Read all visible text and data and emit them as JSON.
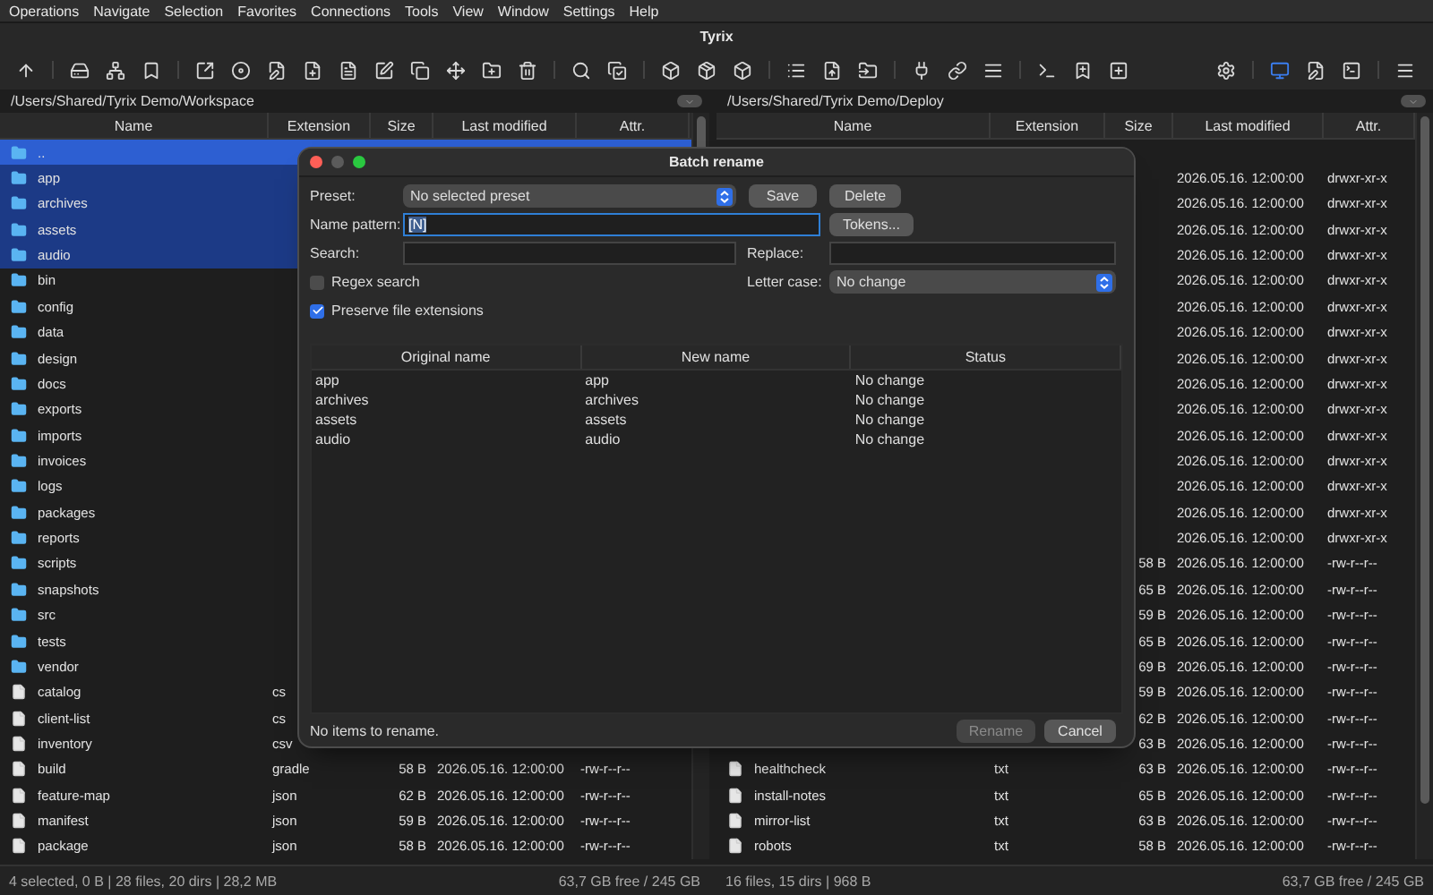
{
  "menu": [
    "Operations",
    "Navigate",
    "Selection",
    "Favorites",
    "Connections",
    "Tools",
    "View",
    "Window",
    "Settings",
    "Help"
  ],
  "window": {
    "title": "Tyrix"
  },
  "toolbar": {
    "groups": [
      {
        "buttons": [
          {
            "selected": false
          }
        ]
      },
      {
        "buttons": [
          {
            "selected": false
          },
          {
            "selected": false
          },
          {
            "selected": false
          }
        ]
      },
      {
        "buttons": [
          {
            "selected": false
          },
          {
            "selected": false
          },
          {
            "selected": false
          },
          {
            "selected": false
          },
          {
            "selected": false
          },
          {
            "selected": false
          },
          {
            "selected": false
          },
          {
            "selected": false
          },
          {
            "selected": false
          },
          {
            "selected": false
          }
        ]
      },
      {
        "buttons": [
          {
            "selected": false
          },
          {
            "selected": false
          }
        ]
      },
      {
        "buttons": [
          {
            "selected": false
          },
          {
            "selected": false
          },
          {
            "selected": false
          }
        ]
      },
      {
        "buttons": [
          {
            "selected": false
          },
          {
            "selected": false
          },
          {
            "selected": false
          }
        ]
      },
      {
        "buttons": [
          {
            "selected": false
          },
          {
            "selected": false
          },
          {
            "selected": false
          }
        ]
      },
      {
        "buttons": [
          {
            "selected": false
          },
          {
            "selected": false
          },
          {
            "selected": false
          }
        ]
      },
      {
        "buttons": [
          {
            "selected": false
          }
        ]
      },
      {
        "buttons": [
          {
            "selected": true
          },
          {
            "selected": false
          },
          {
            "selected": false
          }
        ]
      },
      {
        "buttons": [
          {
            "selected": false
          }
        ]
      }
    ]
  },
  "panels": [
    {
      "path": "/Users/Shared/Tyrix Demo/Workspace",
      "columns": [
        "Name",
        "Extension",
        "Size",
        "Last modified",
        "Attr."
      ],
      "rows": [
        {
          "kind": "folder",
          "name": "..",
          "selected": true,
          "focused": true
        },
        {
          "kind": "folder",
          "name": "app",
          "selected": true,
          "focused": false
        },
        {
          "kind": "folder",
          "name": "archives",
          "selected": true,
          "focused": false
        },
        {
          "kind": "folder",
          "name": "assets",
          "selected": true,
          "focused": false
        },
        {
          "kind": "folder",
          "name": "audio",
          "selected": true,
          "focused": false
        },
        {
          "kind": "folder",
          "name": "bin",
          "selected": false,
          "focused": false
        },
        {
          "kind": "folder",
          "name": "config",
          "selected": false,
          "focused": false
        },
        {
          "kind": "folder",
          "name": "data",
          "selected": false,
          "focused": false
        },
        {
          "kind": "folder",
          "name": "design",
          "selected": false,
          "focused": false
        },
        {
          "kind": "folder",
          "name": "docs",
          "selected": false,
          "focused": false
        },
        {
          "kind": "folder",
          "name": "exports",
          "selected": false,
          "focused": false
        },
        {
          "kind": "folder",
          "name": "imports",
          "selected": false,
          "focused": false
        },
        {
          "kind": "folder",
          "name": "invoices",
          "selected": false,
          "focused": false
        },
        {
          "kind": "folder",
          "name": "logs",
          "selected": false,
          "focused": false
        },
        {
          "kind": "folder",
          "name": "packages",
          "selected": false,
          "focused": false
        },
        {
          "kind": "folder",
          "name": "reports",
          "selected": false,
          "focused": false
        },
        {
          "kind": "folder",
          "name": "scripts",
          "selected": false,
          "focused": false
        },
        {
          "kind": "folder",
          "name": "snapshots",
          "selected": false,
          "focused": false
        },
        {
          "kind": "folder",
          "name": "src",
          "selected": false,
          "focused": false
        },
        {
          "kind": "folder",
          "name": "tests",
          "selected": false,
          "focused": false
        },
        {
          "kind": "folder",
          "name": "vendor",
          "selected": false,
          "focused": false
        },
        {
          "kind": "file",
          "name": "catalog",
          "ext": "cs",
          "selected": false,
          "focused": false
        },
        {
          "kind": "file",
          "name": "client-list",
          "ext": "cs",
          "selected": false,
          "focused": false
        },
        {
          "kind": "file",
          "name": "inventory",
          "ext": "csv",
          "selected": false,
          "focused": false
        },
        {
          "kind": "file",
          "name": "build",
          "ext": "gradle",
          "size": "58 B",
          "modified": "2026.05.16. 12:00:00",
          "attr": "-rw-r--r--",
          "selected": false,
          "focused": false
        },
        {
          "kind": "file",
          "name": "feature-map",
          "ext": "json",
          "size": "62 B",
          "modified": "2026.05.16. 12:00:00",
          "attr": "-rw-r--r--",
          "selected": false,
          "focused": false
        },
        {
          "kind": "file",
          "name": "manifest",
          "ext": "json",
          "size": "59 B",
          "modified": "2026.05.16. 12:00:00",
          "attr": "-rw-r--r--",
          "selected": false,
          "focused": false
        },
        {
          "kind": "file",
          "name": "package",
          "ext": "json",
          "size": "58 B",
          "modified": "2026.05.16. 12:00:00",
          "attr": "-rw-r--r--",
          "selected": false,
          "focused": false
        }
      ],
      "status": {
        "summary": "4 selected, 0 B | 28 files, 20 dirs | 28,2 MB",
        "free_space": "63,7 GB free / 245 GB"
      }
    },
    {
      "path": "/Users/Shared/Tyrix Demo/Deploy",
      "columns": [
        "Name",
        "Extension",
        "Size",
        "Last modified",
        "Attr."
      ],
      "rows": [
        {
          "selected": false,
          "focused": false
        },
        {
          "modified": "2026.05.16. 12:00:00",
          "attr": "drwxr-xr-x",
          "selected": false,
          "focused": false
        },
        {
          "modified": "2026.05.16. 12:00:00",
          "attr": "drwxr-xr-x",
          "selected": false,
          "focused": false
        },
        {
          "modified": "2026.05.16. 12:00:00",
          "attr": "drwxr-xr-x",
          "selected": false,
          "focused": false
        },
        {
          "modified": "2026.05.16. 12:00:00",
          "attr": "drwxr-xr-x",
          "selected": false,
          "focused": false
        },
        {
          "modified": "2026.05.16. 12:00:00",
          "attr": "drwxr-xr-x",
          "selected": false,
          "focused": false
        },
        {
          "modified": "2026.05.16. 12:00:00",
          "attr": "drwxr-xr-x",
          "selected": false,
          "focused": false
        },
        {
          "modified": "2026.05.16. 12:00:00",
          "attr": "drwxr-xr-x",
          "selected": false,
          "focused": false
        },
        {
          "modified": "2026.05.16. 12:00:00",
          "attr": "drwxr-xr-x",
          "selected": false,
          "focused": false
        },
        {
          "modified": "2026.05.16. 12:00:00",
          "attr": "drwxr-xr-x",
          "selected": false,
          "focused": false
        },
        {
          "modified": "2026.05.16. 12:00:00",
          "attr": "drwxr-xr-x",
          "selected": false,
          "focused": false
        },
        {
          "modified": "2026.05.16. 12:00:00",
          "attr": "drwxr-xr-x",
          "selected": false,
          "focused": false
        },
        {
          "modified": "2026.05.16. 12:00:00",
          "attr": "drwxr-xr-x",
          "selected": false,
          "focused": false
        },
        {
          "modified": "2026.05.16. 12:00:00",
          "attr": "drwxr-xr-x",
          "selected": false,
          "focused": false
        },
        {
          "modified": "2026.05.16. 12:00:00",
          "attr": "drwxr-xr-x",
          "selected": false,
          "focused": false
        },
        {
          "modified": "2026.05.16. 12:00:00",
          "attr": "drwxr-xr-x",
          "selected": false,
          "focused": false
        },
        {
          "size": "58 B",
          "modified": "2026.05.16. 12:00:00",
          "attr": "-rw-r--r--",
          "selected": false,
          "focused": false
        },
        {
          "size": "65 B",
          "modified": "2026.05.16. 12:00:00",
          "attr": "-rw-r--r--",
          "selected": false,
          "focused": false
        },
        {
          "size": "59 B",
          "modified": "2026.05.16. 12:00:00",
          "attr": "-rw-r--r--",
          "selected": false,
          "focused": false
        },
        {
          "size": "65 B",
          "modified": "2026.05.16. 12:00:00",
          "attr": "-rw-r--r--",
          "selected": false,
          "focused": false
        },
        {
          "size": "69 B",
          "modified": "2026.05.16. 12:00:00",
          "attr": "-rw-r--r--",
          "selected": false,
          "focused": false
        },
        {
          "size": "59 B",
          "modified": "2026.05.16. 12:00:00",
          "attr": "-rw-r--r--",
          "selected": false,
          "focused": false
        },
        {
          "size": "62 B",
          "modified": "2026.05.16. 12:00:00",
          "attr": "-rw-r--r--",
          "selected": false,
          "focused": false
        },
        {
          "size": "63 B",
          "modified": "2026.05.16. 12:00:00",
          "attr": "-rw-r--r--",
          "selected": false,
          "focused": false
        },
        {
          "kind": "file",
          "name": "healthcheck",
          "ext": "txt",
          "size": "63 B",
          "modified": "2026.05.16. 12:00:00",
          "attr": "-rw-r--r--",
          "selected": false,
          "focused": false
        },
        {
          "kind": "file",
          "name": "install-notes",
          "ext": "txt",
          "size": "65 B",
          "modified": "2026.05.16. 12:00:00",
          "attr": "-rw-r--r--",
          "selected": false,
          "focused": false
        },
        {
          "kind": "file",
          "name": "mirror-list",
          "ext": "txt",
          "size": "63 B",
          "modified": "2026.05.16. 12:00:00",
          "attr": "-rw-r--r--",
          "selected": false,
          "focused": false
        },
        {
          "kind": "file",
          "name": "robots",
          "ext": "txt",
          "size": "58 B",
          "modified": "2026.05.16. 12:00:00",
          "attr": "-rw-r--r--",
          "selected": false,
          "focused": false
        }
      ],
      "status": {
        "summary": "16 files, 15 dirs | 968 B",
        "free_space": "63,7 GB free / 245 GB"
      }
    }
  ],
  "dialog": {
    "title": "Batch rename",
    "preset": {
      "label": "Preset:",
      "value": "No selected preset"
    },
    "save_button": "Save",
    "delete_button": "Delete",
    "name_pattern": {
      "label": "Name pattern:",
      "value": "[N]"
    },
    "tokens_button": "Tokens...",
    "search": {
      "label": "Search:"
    },
    "replace": {
      "label": "Replace:"
    },
    "options": [
      {
        "label": "Regex search",
        "checked": false
      },
      {
        "label": "Preserve file extensions",
        "checked": true
      }
    ],
    "letter_case": {
      "label": "Letter case:",
      "value": "No change"
    },
    "table": {
      "columns": [
        "Original name",
        "New name",
        "Status"
      ],
      "rows": [
        [
          "app",
          "app",
          "No change"
        ],
        [
          "archives",
          "archives",
          "No change"
        ],
        [
          "assets",
          "assets",
          "No change"
        ],
        [
          "audio",
          "audio",
          "No change"
        ]
      ]
    },
    "message": "No items to rename.",
    "buttons": [
      {
        "label": "Rename",
        "disabled": true
      },
      {
        "label": "Cancel",
        "disabled": false
      }
    ]
  }
}
